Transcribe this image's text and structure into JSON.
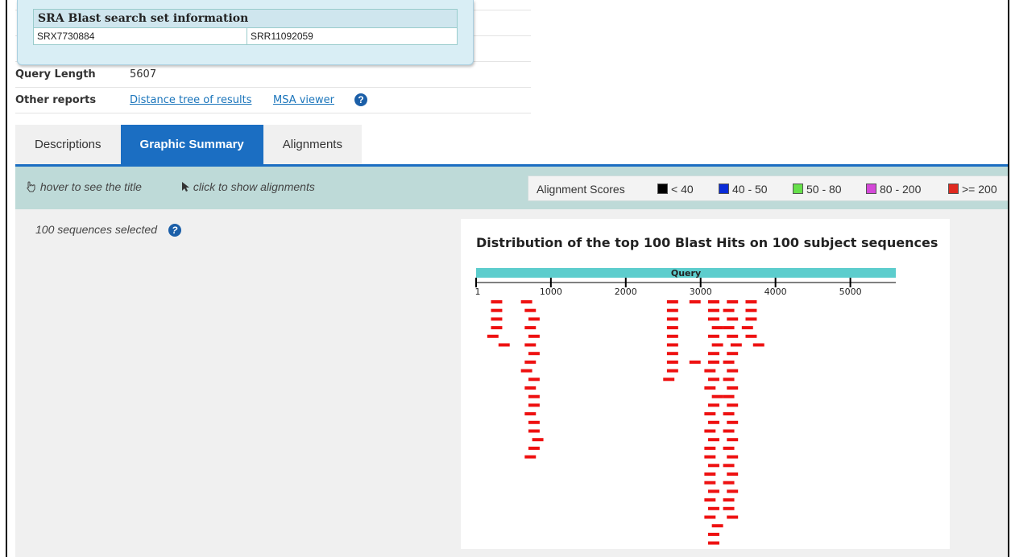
{
  "sra": {
    "title": "SRA Blast search set information",
    "experiment": "SRX7730884",
    "run": "SRR11092059"
  },
  "query_length": {
    "label": "Query Length",
    "value": "5607"
  },
  "other_reports": {
    "label": "Other reports",
    "links": [
      "Distance tree of results",
      "MSA viewer"
    ],
    "help_icon": "question-circle-icon"
  },
  "tabs": [
    {
      "label": "Descriptions",
      "active": false
    },
    {
      "label": "Graphic Summary",
      "active": true
    },
    {
      "label": "Alignments",
      "active": false
    }
  ],
  "toolbar": {
    "hover_hint": "hover to see the title",
    "click_hint": "click to show alignments",
    "hover_icon": "pointing-hand-icon",
    "click_icon": "arrow-cursor-icon"
  },
  "legend": {
    "title": "Alignment Scores",
    "items": [
      {
        "label": "< 40",
        "color": "#000000"
      },
      {
        "label": "40 - 50",
        "color": "#0a2cd8"
      },
      {
        "label": "50 - 80",
        "color": "#66e04a"
      },
      {
        "label": "80 - 200",
        "color": "#d448d8"
      },
      {
        "label": ">= 200",
        "color": "#e02a20"
      }
    ]
  },
  "selection": {
    "text": "100 sequences selected"
  },
  "chart_data": {
    "type": "alignment-map",
    "title": "Distribution of the top 100 Blast Hits on 100 subject sequences",
    "query_label": "Query",
    "query_length": 5607,
    "query_color": "#5ccdcd",
    "hit_color": "#ee1111",
    "ticks": [
      "1",
      "1000",
      "2000",
      "3000",
      "4000",
      "5000"
    ],
    "tick_values": [
      1,
      1000,
      2000,
      3000,
      4000,
      5000
    ],
    "hits": [
      {
        "start": 200,
        "end": 350,
        "row": 0
      },
      {
        "start": 600,
        "end": 750,
        "row": 0
      },
      {
        "start": 2550,
        "end": 2700,
        "row": 0
      },
      {
        "start": 2850,
        "end": 3000,
        "row": 0
      },
      {
        "start": 3100,
        "end": 3250,
        "row": 0
      },
      {
        "start": 3350,
        "end": 3500,
        "row": 0
      },
      {
        "start": 3600,
        "end": 3750,
        "row": 0
      },
      {
        "start": 200,
        "end": 350,
        "row": 1
      },
      {
        "start": 650,
        "end": 800,
        "row": 1
      },
      {
        "start": 2550,
        "end": 2700,
        "row": 1
      },
      {
        "start": 3100,
        "end": 3250,
        "row": 1
      },
      {
        "start": 3300,
        "end": 3450,
        "row": 1
      },
      {
        "start": 3600,
        "end": 3750,
        "row": 1
      },
      {
        "start": 200,
        "end": 350,
        "row": 2
      },
      {
        "start": 700,
        "end": 850,
        "row": 2
      },
      {
        "start": 2550,
        "end": 2700,
        "row": 2
      },
      {
        "start": 3100,
        "end": 3250,
        "row": 2
      },
      {
        "start": 3350,
        "end": 3500,
        "row": 2
      },
      {
        "start": 3600,
        "end": 3750,
        "row": 2
      },
      {
        "start": 200,
        "end": 350,
        "row": 3
      },
      {
        "start": 650,
        "end": 800,
        "row": 3
      },
      {
        "start": 2550,
        "end": 2700,
        "row": 3
      },
      {
        "start": 3150,
        "end": 3300,
        "row": 3
      },
      {
        "start": 3300,
        "end": 3450,
        "row": 3
      },
      {
        "start": 3550,
        "end": 3700,
        "row": 3
      },
      {
        "start": 150,
        "end": 300,
        "row": 4
      },
      {
        "start": 700,
        "end": 850,
        "row": 4
      },
      {
        "start": 2550,
        "end": 2700,
        "row": 4
      },
      {
        "start": 3100,
        "end": 3250,
        "row": 4
      },
      {
        "start": 3350,
        "end": 3500,
        "row": 4
      },
      {
        "start": 3600,
        "end": 3750,
        "row": 4
      },
      {
        "start": 300,
        "end": 450,
        "row": 5
      },
      {
        "start": 650,
        "end": 800,
        "row": 5
      },
      {
        "start": 2550,
        "end": 2700,
        "row": 5
      },
      {
        "start": 3150,
        "end": 3300,
        "row": 5
      },
      {
        "start": 3400,
        "end": 3550,
        "row": 5
      },
      {
        "start": 3700,
        "end": 3850,
        "row": 5
      },
      {
        "start": 700,
        "end": 850,
        "row": 6
      },
      {
        "start": 2550,
        "end": 2700,
        "row": 6
      },
      {
        "start": 3100,
        "end": 3250,
        "row": 6
      },
      {
        "start": 3350,
        "end": 3500,
        "row": 6
      },
      {
        "start": 650,
        "end": 800,
        "row": 7
      },
      {
        "start": 2550,
        "end": 2700,
        "row": 7
      },
      {
        "start": 2850,
        "end": 3000,
        "row": 7
      },
      {
        "start": 3100,
        "end": 3250,
        "row": 7
      },
      {
        "start": 3300,
        "end": 3450,
        "row": 7
      },
      {
        "start": 600,
        "end": 750,
        "row": 8
      },
      {
        "start": 2550,
        "end": 2700,
        "row": 8
      },
      {
        "start": 3050,
        "end": 3200,
        "row": 8
      },
      {
        "start": 3350,
        "end": 3500,
        "row": 8
      },
      {
        "start": 700,
        "end": 850,
        "row": 9
      },
      {
        "start": 2500,
        "end": 2650,
        "row": 9
      },
      {
        "start": 3100,
        "end": 3250,
        "row": 9
      },
      {
        "start": 3300,
        "end": 3450,
        "row": 9
      },
      {
        "start": 650,
        "end": 800,
        "row": 10
      },
      {
        "start": 3050,
        "end": 3200,
        "row": 10
      },
      {
        "start": 3350,
        "end": 3500,
        "row": 10
      },
      {
        "start": 700,
        "end": 850,
        "row": 11
      },
      {
        "start": 3150,
        "end": 3300,
        "row": 11
      },
      {
        "start": 3300,
        "end": 3450,
        "row": 11
      },
      {
        "start": 700,
        "end": 850,
        "row": 12
      },
      {
        "start": 3100,
        "end": 3250,
        "row": 12
      },
      {
        "start": 3350,
        "end": 3500,
        "row": 12
      },
      {
        "start": 650,
        "end": 800,
        "row": 13
      },
      {
        "start": 3050,
        "end": 3200,
        "row": 13
      },
      {
        "start": 3300,
        "end": 3450,
        "row": 13
      },
      {
        "start": 700,
        "end": 850,
        "row": 14
      },
      {
        "start": 3100,
        "end": 3250,
        "row": 14
      },
      {
        "start": 3350,
        "end": 3500,
        "row": 14
      },
      {
        "start": 700,
        "end": 850,
        "row": 15
      },
      {
        "start": 3050,
        "end": 3200,
        "row": 15
      },
      {
        "start": 3300,
        "end": 3450,
        "row": 15
      },
      {
        "start": 750,
        "end": 900,
        "row": 16
      },
      {
        "start": 3100,
        "end": 3250,
        "row": 16
      },
      {
        "start": 3350,
        "end": 3500,
        "row": 16
      },
      {
        "start": 700,
        "end": 850,
        "row": 17
      },
      {
        "start": 3050,
        "end": 3200,
        "row": 17
      },
      {
        "start": 3300,
        "end": 3450,
        "row": 17
      },
      {
        "start": 650,
        "end": 800,
        "row": 18
      },
      {
        "start": 3050,
        "end": 3200,
        "row": 18
      },
      {
        "start": 3350,
        "end": 3500,
        "row": 18
      },
      {
        "start": 3100,
        "end": 3250,
        "row": 19
      },
      {
        "start": 3300,
        "end": 3450,
        "row": 19
      },
      {
        "start": 3050,
        "end": 3200,
        "row": 20
      },
      {
        "start": 3350,
        "end": 3500,
        "row": 20
      },
      {
        "start": 3050,
        "end": 3200,
        "row": 21
      },
      {
        "start": 3300,
        "end": 3450,
        "row": 21
      },
      {
        "start": 3100,
        "end": 3250,
        "row": 22
      },
      {
        "start": 3350,
        "end": 3500,
        "row": 22
      },
      {
        "start": 3050,
        "end": 3200,
        "row": 23
      },
      {
        "start": 3300,
        "end": 3450,
        "row": 23
      },
      {
        "start": 3100,
        "end": 3250,
        "row": 24
      },
      {
        "start": 3300,
        "end": 3450,
        "row": 24
      },
      {
        "start": 3050,
        "end": 3200,
        "row": 25
      },
      {
        "start": 3350,
        "end": 3500,
        "row": 25
      },
      {
        "start": 3150,
        "end": 3300,
        "row": 26
      },
      {
        "start": 3100,
        "end": 3250,
        "row": 27
      },
      {
        "start": 3100,
        "end": 3250,
        "row": 28
      }
    ]
  }
}
